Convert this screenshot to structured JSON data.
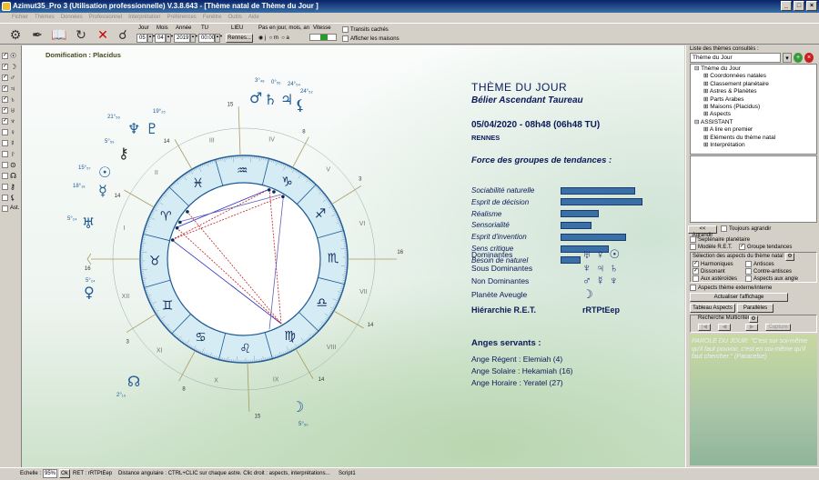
{
  "window": {
    "title": "Azimut35_Pro 3 (Utilisation professionnelle) V.3.8.643 - [Thème natal de Thème du Jour ]"
  },
  "menu": [
    "Fichier",
    "Thèmes",
    "Données",
    "Professionnel",
    "Interprétation",
    "Préférences",
    "Fenêtre",
    "Outils",
    "Aide"
  ],
  "toolbar": {
    "jour_label": "Jour",
    "jour": "05",
    "mois_label": "Mois",
    "mois": "04",
    "annee_label": "Année",
    "annee": "2019",
    "tu_label": "TU",
    "tu": "00:00",
    "lieu_label": "LIEU",
    "lieu": "Rennes...",
    "pas_label": "Pas en jour, mois, an",
    "pas_options": [
      "j",
      "m",
      "a"
    ],
    "vitesse_label": "Vitesse",
    "transits_label": "Transits cachés",
    "maisons_label": "Afficher les maisons"
  },
  "left_strip": [
    {
      "checked": true,
      "glyph": "☉"
    },
    {
      "checked": true,
      "glyph": "☽"
    },
    {
      "checked": true,
      "glyph": "♂"
    },
    {
      "checked": true,
      "glyph": "♃"
    },
    {
      "checked": true,
      "glyph": "♄"
    },
    {
      "checked": true,
      "glyph": "♅"
    },
    {
      "checked": true,
      "glyph": "♆"
    },
    {
      "checked": false,
      "glyph": "♀"
    },
    {
      "checked": false,
      "glyph": "☿"
    },
    {
      "checked": false,
      "glyph": "♇"
    },
    {
      "checked": false,
      "glyph": "⊙"
    },
    {
      "checked": false,
      "glyph": "☊"
    },
    {
      "checked": false,
      "glyph": "⚷"
    },
    {
      "checked": false,
      "glyph": "⚸"
    },
    {
      "checked": false,
      "glyph": "Ast."
    }
  ],
  "chart": {
    "domification": "Domification : Placidus",
    "houses": [
      "I",
      "II",
      "III",
      "IV",
      "V",
      "VI",
      "VII",
      "VIII",
      "IX",
      "X",
      "XI",
      "XII"
    ],
    "signs": [
      "♈",
      "♉",
      "♊",
      "♋",
      "♌",
      "♍",
      "♎",
      "♏",
      "♐",
      "♑",
      "♒",
      "♓"
    ],
    "cusp_degrees": [
      "16",
      "14",
      "14",
      "15",
      "8",
      "3",
      "16",
      "14",
      "14",
      "15",
      "8",
      "3"
    ],
    "planets": [
      {
        "glyph": "♀",
        "deg": "5°₂₄",
        "color": "#1d5a96"
      },
      {
        "glyph": "♅",
        "deg": "5°₂₄",
        "color": "#1d5a96"
      },
      {
        "glyph": "⚷",
        "deg": "5°₅₉",
        "color": "#2a2a2a"
      },
      {
        "glyph": "☊",
        "deg": "2°₁₉",
        "color": "#1d5a96"
      },
      {
        "glyph": "☽",
        "deg": "5°₅₀",
        "color": "#1d5a96"
      },
      {
        "glyph": "☉",
        "deg": "15°₅₇",
        "color": "#1d5a96"
      },
      {
        "glyph": "☿",
        "deg": "18°₁₈",
        "color": "#1d5a96"
      },
      {
        "glyph": "♆",
        "deg": "21°₅₆",
        "color": "#1d5a96"
      },
      {
        "glyph": "♇",
        "deg": "19°₂₅",
        "color": "#1d5a96"
      },
      {
        "glyph": "♂",
        "deg": "3°₄₈",
        "color": "#1d5a96"
      },
      {
        "glyph": "♄",
        "deg": "0°₅₆",
        "color": "#1d5a96"
      },
      {
        "glyph": "♃",
        "deg": "24°₅₄",
        "color": "#1d5a96"
      },
      {
        "glyph": "⚸",
        "deg": "24°₅₂",
        "color": "#1d5a96"
      }
    ]
  },
  "theme": {
    "title": "THÈME DU JOUR",
    "subtitle": "Bélier Ascendant Taureau",
    "date": "05/04/2020 - 08h48 (06h48 TU)",
    "city": "RENNES",
    "force_heading": "Force des groupes de tendances :",
    "forces": [
      {
        "label": "Sociabilité naturelle",
        "value": 0.68
      },
      {
        "label": "Esprit de décision",
        "value": 0.75
      },
      {
        "label": "Réalisme",
        "value": 0.35
      },
      {
        "label": "Sensorialité",
        "value": 0.28
      },
      {
        "label": "Esprit d'invention",
        "value": 0.6
      },
      {
        "label": "Sens critique",
        "value": 0.44
      },
      {
        "label": "Besoin de naturel",
        "value": 0.18
      }
    ],
    "dominantes": [
      {
        "label": "Dominantes",
        "glyphs": "♅♀☉"
      },
      {
        "label": "Sous Dominantes",
        "glyphs": "♆♃♄"
      },
      {
        "label": "Non Dominantes",
        "glyphs": "♂☿♆"
      },
      {
        "label": "Planète Aveugle",
        "glyphs": "☽"
      }
    ],
    "ret_label": "Hiérarchie R.E.T.",
    "ret_value": "rRTPtEep",
    "anges_heading": "Anges servants :",
    "anges": [
      "Ange Régent : Elemiah (4)",
      "Ange Solaire : Hekamiah (16)",
      "Ange Horaire : Yeratel (27)"
    ]
  },
  "right_panel": {
    "list_label": "Liste des thèmes consultés :",
    "selected": "Thème du Jour",
    "tree": [
      {
        "level": 0,
        "text": "⊟ Thème du Jour"
      },
      {
        "level": 1,
        "text": "⊞ Coordonnées natales"
      },
      {
        "level": 1,
        "text": "⊞ Classement planétaire"
      },
      {
        "level": 1,
        "text": "⊞ Astres & Planètes"
      },
      {
        "level": 1,
        "text": "⊞ Parts Arabes"
      },
      {
        "level": 1,
        "text": "⊞ Maisons (Placidus)"
      },
      {
        "level": 1,
        "text": "⊞ Aspects"
      },
      {
        "level": 0,
        "text": "⊟ ASSISTANT"
      },
      {
        "level": 1,
        "text": "⊞ A lire en premier"
      },
      {
        "level": 1,
        "text": "⊞ Eléments du thème natal"
      },
      {
        "level": 1,
        "text": "⊞ Interprétation"
      }
    ],
    "agrandir": "<< Agrandir",
    "toujours_agrandir": "Toujours agrandir",
    "septenaire": "Septénaire planétaire",
    "modele_ret": "Modèle R.E.T.",
    "groupe_tendances": "Groupe tendances",
    "selection_aspects": "Sélection des aspects du thème natal",
    "harmoniques": "Harmoniques",
    "antisces": "Antisces",
    "dissonant": "Dissonant",
    "contre_antisces": "Contre-antisces",
    "asteroides": "Aux astéroïdes",
    "aspects_angle": "Aspects aux angle",
    "aspects_ext": "Aspects thème externe/interne",
    "actualiser": "Actualiser l'affichage",
    "tableau_aspects": "Tableau Aspects",
    "paralleles": "Parallèles",
    "recherche": "Recherche Multicritère",
    "capture": "Capture",
    "parole": "PAROLE DU JOUR: \"C'est sur soi-même qu'il faut pouvoir, c'est en soi-même qu'il faut chercher.\" (Paracelse)"
  },
  "status": {
    "echelle_label": "Echelle :",
    "echelle": "95%",
    "ok": "Ok",
    "ret": "RET : rRTPtEep",
    "hint": "Distance angulaire : CTRL+CLIC sur chaque astre. Clic droit : aspects, interprétations...",
    "script": "Script1"
  }
}
